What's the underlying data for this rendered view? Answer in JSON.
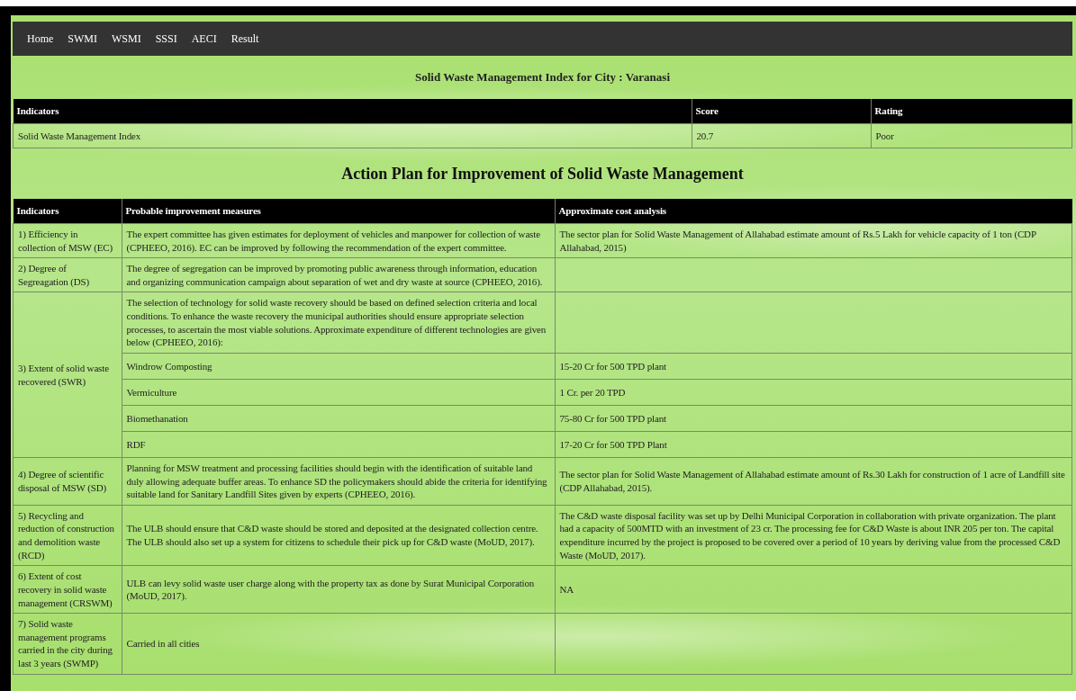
{
  "nav": [
    {
      "label": "Home"
    },
    {
      "label": "SWMI"
    },
    {
      "label": "WSMI"
    },
    {
      "label": "SSSI"
    },
    {
      "label": "AECI"
    },
    {
      "label": "Result"
    }
  ],
  "summary": {
    "title": "Solid Waste Management Index for City : Varanasi",
    "columns": [
      "Indicators",
      "Score",
      "Rating"
    ],
    "rows": [
      {
        "indicator": "Solid Waste Management Index",
        "score": "20.7",
        "rating": "Poor"
      }
    ]
  },
  "action_plan": {
    "title": "Action Plan for Improvement of Solid Waste Management",
    "columns": [
      "Indicators",
      "Probable improvement measures",
      "Approximate cost analysis"
    ],
    "rows": [
      {
        "indicator": "1) Efficiency in collection of MSW (EC)",
        "measure": "The expert committee has given estimates for deployment of vehicles and manpower for collection of waste (CPHEEO, 2016). EC can be improved by following the recommendation of the expert committee.",
        "cost": "The sector plan for Solid Waste Management of Allahabad estimate amount of Rs.5 Lakh for vehicle capacity of 1 ton (CDP Allahabad, 2015)"
      },
      {
        "indicator": "2) Degree of Segreagation (DS)",
        "measure": "The degree of segregation can be improved by promoting public awareness through information, education and organizing communication campaign about separation of wet and dry waste at source (CPHEEO, 2016)."
      },
      {
        "indicator": "3) Extent of solid waste recovered (SWR)",
        "measure": "The selection of technology for solid waste recovery should be based on defined selection criteria and local conditions. To enhance the waste recovery the municipal authorities should ensure appropriate selection processes, to ascertain the most viable solutions. Approximate expenditure of different technologies are given below (CPHEEO, 2016):",
        "items": [
          {
            "measure": "Windrow Composting",
            "cost": "15-20 Cr for 500 TPD plant"
          },
          {
            "measure": "Vermiculture",
            "cost": "1 Cr. per 20 TPD"
          },
          {
            "measure": "Biomethanation",
            "cost": "75-80 Cr for 500 TPD plant"
          },
          {
            "measure": "RDF",
            "cost": "17-20 Cr for 500 TPD Plant"
          }
        ]
      },
      {
        "indicator": "4) Degree of scientific disposal of MSW (SD)",
        "measure": "Planning for MSW treatment and processing facilities should begin with the identification of suitable land duly allowing adequate buffer areas. To enhance SD the policymakers should abide the criteria for identifying suitable land for Sanitary Landfill Sites given by experts (CPHEEO, 2016).",
        "cost": "The sector plan for Solid Waste Management of Allahabad estimate amount of Rs.30 Lakh for construction of 1 acre of Landfill site (CDP Allahabad, 2015)."
      },
      {
        "indicator": "5) Recycling and reduction of construction and demolition waste (RCD)",
        "measure": "The ULB should ensure that C&D waste should be stored and deposited at the designated collection centre. The ULB should also set up a system for citizens to schedule their pick up for C&D waste (MoUD, 2017).",
        "cost": "The C&D waste disposal facility was set up by Delhi Municipal Corporation in collaboration with private organization. The plant had a capacity of 500MTD with an investment of 23 cr. The processing fee for C&D Waste is about INR 205 per ton. The capital expenditure incurred by the project is proposed to be covered over a period of 10 years by deriving value from the processed C&D Waste (MoUD, 2017)."
      },
      {
        "indicator": "6) Extent of cost recovery in solid waste management (CRSWM)",
        "measure": "ULB can levy solid waste user charge along with the property tax as done by Surat Municipal Corporation (MoUD, 2017).",
        "cost": "NA"
      },
      {
        "indicator": "7) Solid waste management programs carried in the city during last 3 years (SWMP)",
        "measure": "Carried in all cities"
      }
    ]
  }
}
